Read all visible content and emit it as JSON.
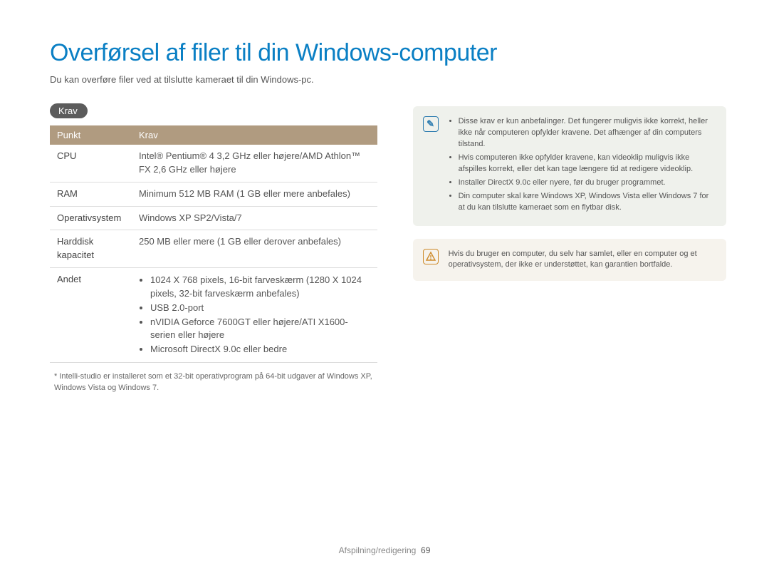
{
  "title": "Overførsel af filer til din Windows-computer",
  "subtitle": "Du kan overføre filer ved at tilslutte kameraet til din Windows-pc.",
  "section_badge": "Krav",
  "table": {
    "head": {
      "c1": "Punkt",
      "c2": "Krav"
    },
    "rows": {
      "cpu": {
        "label": "CPU",
        "value": "Intel® Pentium® 4 3,2 GHz eller højere/AMD Athlon™ FX 2,6 GHz eller højere"
      },
      "ram": {
        "label": "RAM",
        "value": "Minimum 512 MB RAM (1 GB eller mere anbefales)"
      },
      "os": {
        "label": "Operativsystem",
        "value": "Windows XP SP2/Vista/7"
      },
      "hdd": {
        "label": "Harddisk kapacitet",
        "value": "250 MB eller mere (1 GB eller derover anbefales)"
      },
      "other": {
        "label": "Andet",
        "items": [
          "1024 X 768 pixels, 16-bit farveskærm (1280 X 1024 pixels, 32-bit farveskærm anbefales)",
          "USB 2.0-port",
          "nVIDIA Geforce 7600GT eller højere/ATI X1600-serien eller højere",
          "Microsoft DirectX 9.0c eller bedre"
        ]
      }
    }
  },
  "footnote": "* Intelli-studio er installeret som et 32-bit operativprogram på 64-bit udgaver af Windows XP, Windows Vista og Windows 7.",
  "info_note": {
    "items": [
      "Disse krav er kun anbefalinger. Det fungerer muligvis ikke korrekt, heller ikke når computeren opfylder kravene. Det afhænger af din computers tilstand.",
      "Hvis computeren ikke opfylder kravene, kan videoklip muligvis ikke afspilles korrekt, eller det kan tage længere tid at redigere videoklip.",
      "Installer DirectX 9.0c eller nyere, før du bruger programmet.",
      "Din computer skal køre Windows XP, Windows Vista eller Windows 7 for at du kan tilslutte kameraet som en flytbar disk."
    ]
  },
  "warn_note": "Hvis du bruger en computer, du selv har samlet, eller en computer og et operativsystem, der ikke er understøttet, kan garantien bortfalde.",
  "footer": {
    "section": "Afspilning/redigering",
    "page": "69"
  }
}
